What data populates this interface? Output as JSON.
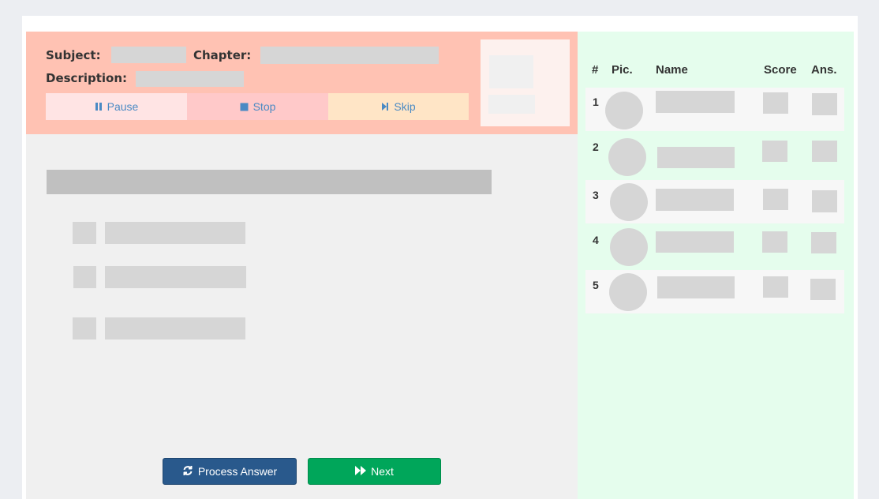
{
  "question_header": {
    "subject_label": "Subject:",
    "chapter_label": "Chapter:",
    "description_label": "Description:"
  },
  "controls": {
    "pause_label": "Pause",
    "stop_label": "Stop",
    "skip_label": "Skip"
  },
  "footer": {
    "process_answer_label": "Process Answer",
    "next_label": "Next"
  },
  "leaderboard": {
    "columns": [
      "#",
      "Pic.",
      "Name",
      "Score",
      "Ans."
    ],
    "rows": [
      {
        "rank": "1"
      },
      {
        "rank": "2"
      },
      {
        "rank": "3"
      },
      {
        "rank": "4"
      },
      {
        "rank": "5"
      }
    ]
  },
  "colors": {
    "header_bg": "#ffc2b3",
    "pause_bg": "#ffe4e4",
    "stop_bg": "#ffc9c9",
    "skip_bg": "#ffe5c6",
    "control_text": "#4a8ac4",
    "process_button": "#29598c",
    "next_button": "#00a65a",
    "leaderboard_bg": "#e5fded"
  },
  "icons": {
    "pause": "pause-icon",
    "stop": "stop-icon",
    "skip": "skip-icon",
    "process": "refresh-icon",
    "next": "fast-forward-icon"
  }
}
